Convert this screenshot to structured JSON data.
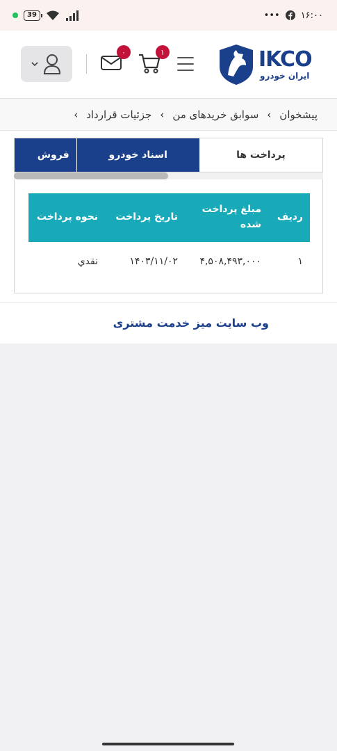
{
  "status": {
    "time": "۱۶:۰۰",
    "battery": "39",
    "menu_dots": "•••"
  },
  "header": {
    "mail_badge": "۰",
    "cart_badge": "۱",
    "logo_latin": "IKCO",
    "logo_persian": "ایران خودرو"
  },
  "breadcrumb": {
    "items": [
      "پیشخوان",
      "سوابق خریدهای من",
      "جزئیات قرارداد"
    ],
    "separator": "›"
  },
  "tabs": {
    "active": "پرداخت ها",
    "second": "اسناد خودرو",
    "third": "فروش"
  },
  "table": {
    "headers": [
      "ردیف",
      "مبلغ پرداخت شده",
      "تاریخ پرداخت",
      "نحوه پرداخت"
    ],
    "rows": [
      [
        "۱",
        "۴,۵۰۸,۴۹۳,۰۰۰",
        "۱۴۰۳/۱۱/۰۲",
        "نقدي"
      ]
    ]
  },
  "footer": {
    "link": "وب سایت میز خدمت مشتری"
  },
  "colors": {
    "brand": "#1a3f8b",
    "teal": "#18aab8",
    "badge": "#c2123a"
  }
}
